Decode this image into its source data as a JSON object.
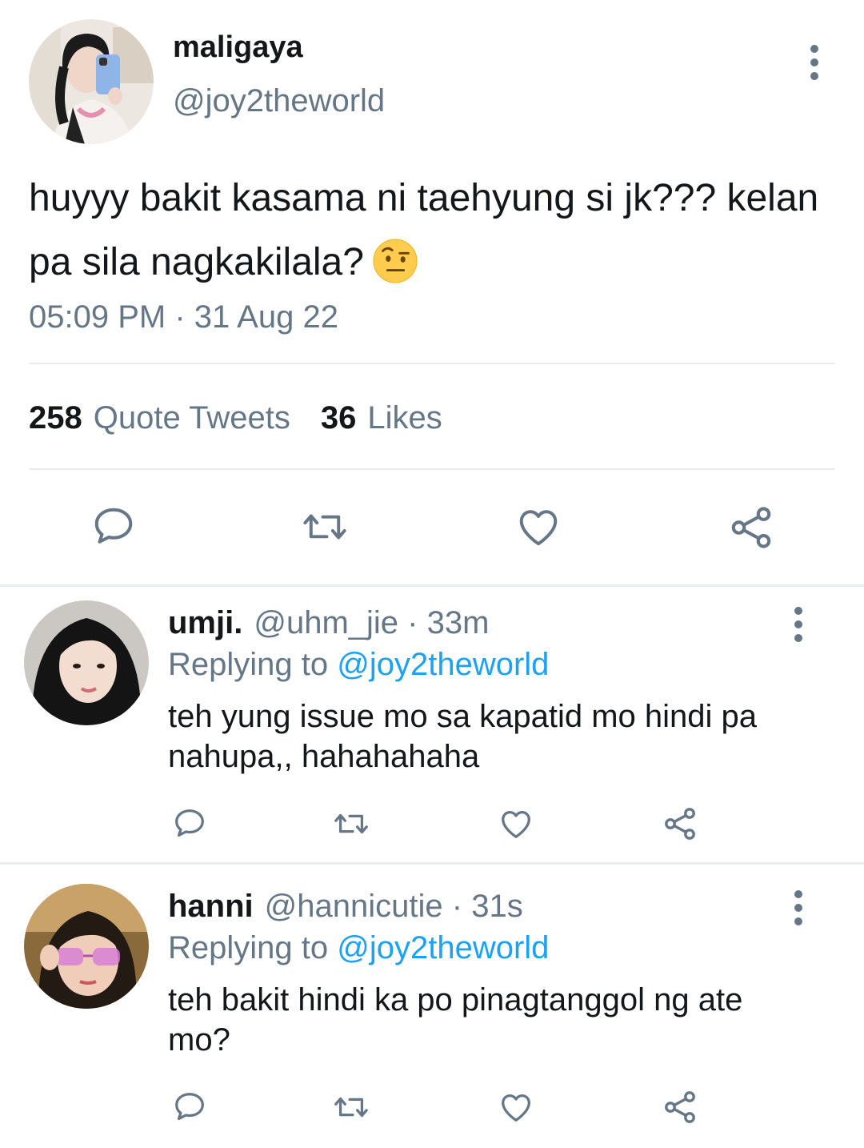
{
  "main_tweet": {
    "display_name": "maligaya",
    "handle": "@joy2theworld",
    "text": "huyyy bakit kasama ni taehyung si jk??? kelan pa sila nagkakilala?",
    "emoji": "raised-eyebrow-face-icon",
    "timestamp": "05:09 PM · 31 Aug 22",
    "stats": {
      "quote_count": "258",
      "quote_label": "Quote Tweets",
      "likes_count": "36",
      "likes_label": "Likes"
    }
  },
  "replies": [
    {
      "display_name": "umji.",
      "handle": "@uhm_jie",
      "time": "· 33m",
      "replying_label": "Replying to",
      "replying_to": "@joy2theworld",
      "text_line1": "teh yung issue mo sa kapatid mo hindi pa",
      "text_line2": "nahupa,, hahahahaha"
    },
    {
      "display_name": "hanni",
      "handle": "@hannicutie",
      "time": "· 31s",
      "replying_label": "Replying to",
      "replying_to": "@joy2theworld",
      "text_line1": "teh bakit hindi ka po pinagtanggol ng ate",
      "text_line2": "mo?"
    }
  ],
  "icons": {
    "reply": "reply-icon",
    "retweet": "retweet-icon",
    "like": "heart-icon",
    "share": "share-icon",
    "more": "more-options-icon"
  },
  "colors": {
    "text": "#14171a",
    "secondary": "#657786",
    "link": "#1da1f2",
    "divider": "#e6ecf0"
  }
}
